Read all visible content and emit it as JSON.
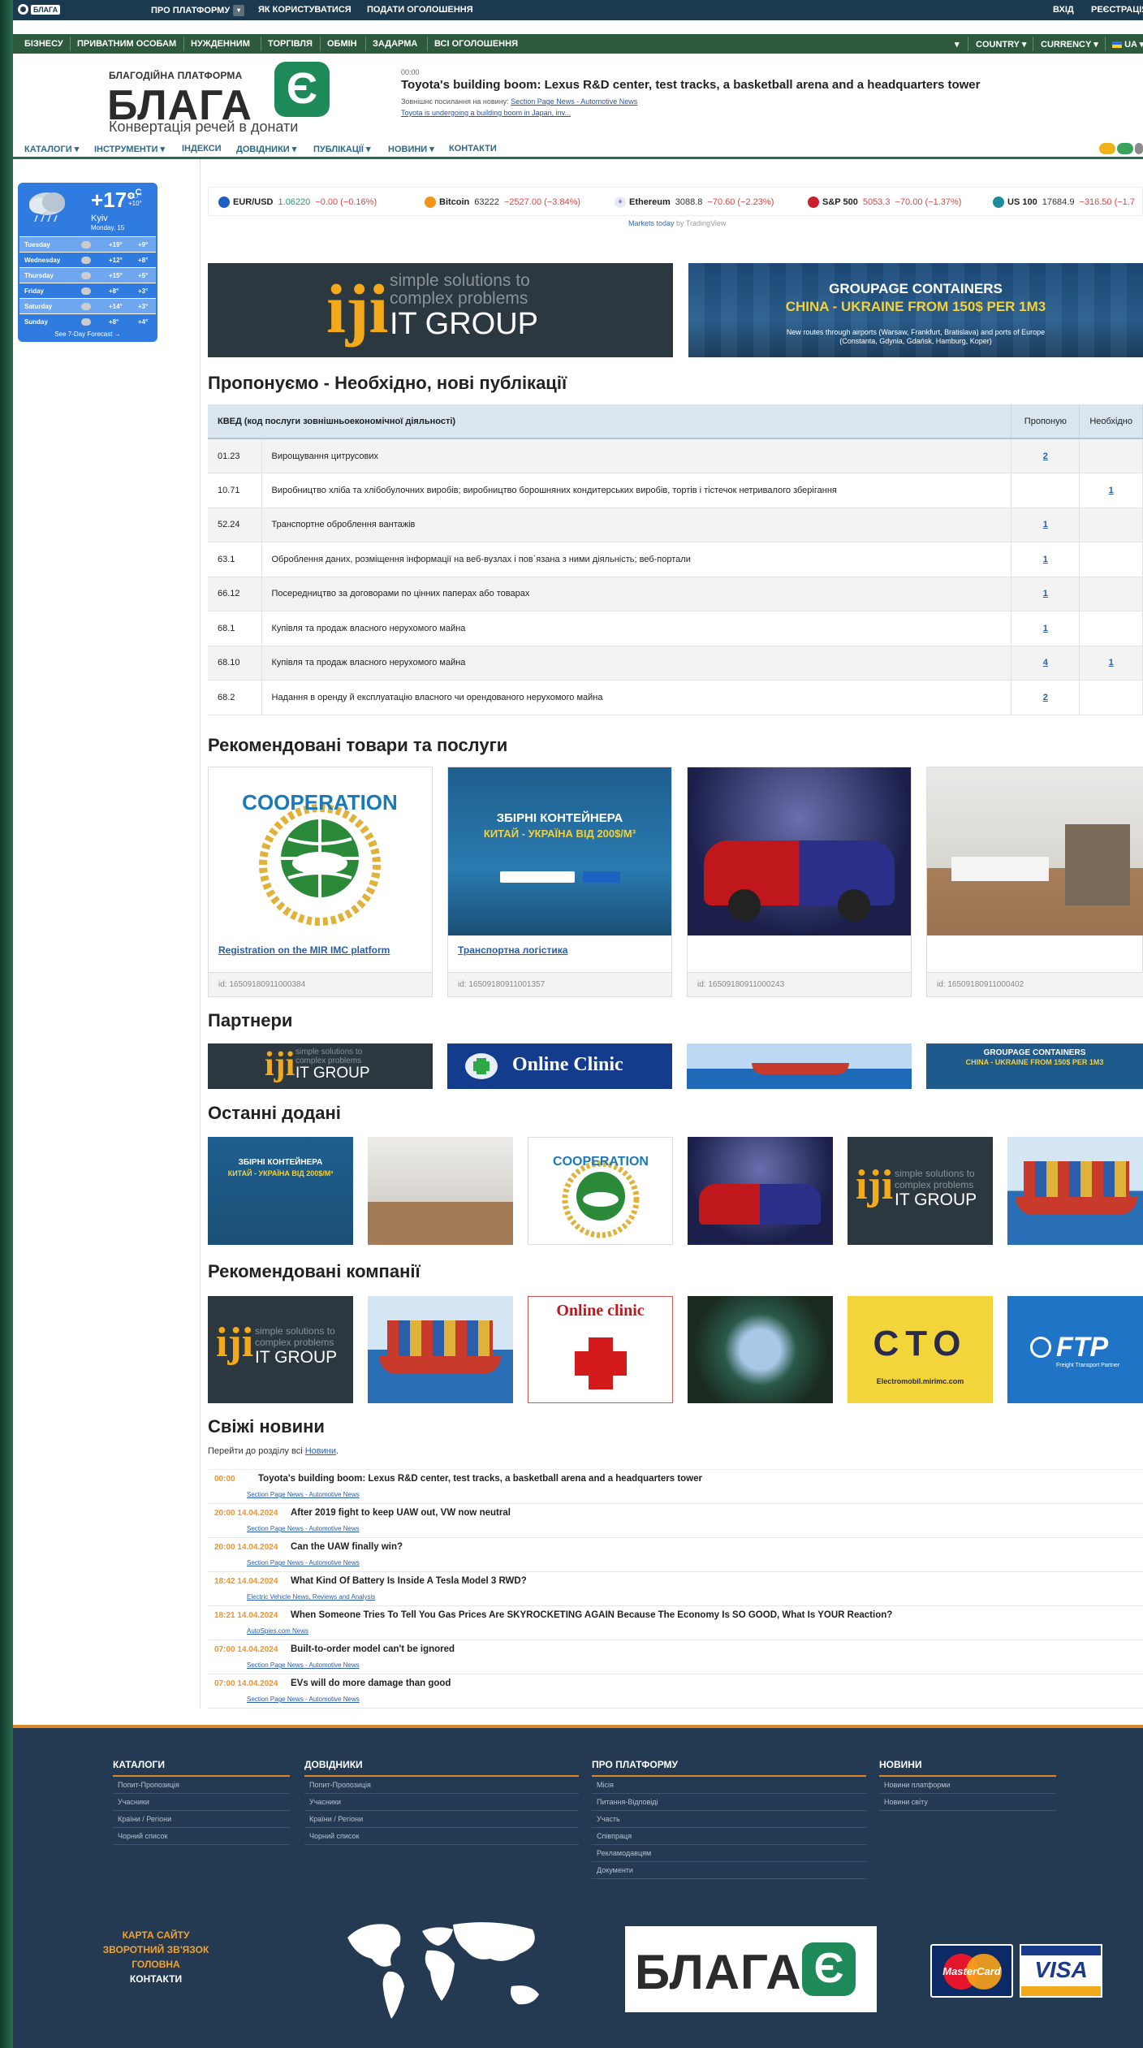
{
  "topbar": {
    "logo_mini": "БЛАГА",
    "items": [
      "ПРО ПЛАТФОРМУ",
      "ЯК КОРИСТУВАТИСЯ",
      "ПОДАТИ ОГОЛОШЕННЯ"
    ],
    "login": "ВХІД",
    "register": "РЕЄСТРАЦІЯ"
  },
  "navbar2": {
    "items": [
      "БІЗНЕСУ",
      "ПРИВАТНИМ ОСОБАМ",
      "НУЖДЕННИМ",
      "ТОРГІВЛЯ",
      "ОБМІН",
      "ЗАДАРМА",
      "ВСІ ОГОЛОШЕННЯ"
    ],
    "country": "COUNTRY",
    "currency": "CURRENCY",
    "lang": "UA"
  },
  "header": {
    "brand_sub": "БЛАГОДІЙНА ПЛАТФОРМА",
    "brand_main": "БЛАГА",
    "brand_e": "Є",
    "brand_tag": "Конвертація речей в донати",
    "news_time": "00:00",
    "news_headline": "Toyota's building boom: Lexus R&D center, test tracks, a basketball arena and a headquarters tower",
    "news_src_label": "Зовнішнє посилання на новину:",
    "news_src_link": "Section Page News - Automotive News",
    "news_next": "Toyota is undergoing a building boom in Japan, inv..."
  },
  "menu3": {
    "items": [
      "КАТАЛОГИ",
      "ІНСТРУМЕНТИ",
      "ІНДЕКСИ",
      "ДОВІДНИКИ",
      "ПУБЛІКАЦІЇ",
      "НОВИНИ",
      "КОНТАКТИ"
    ]
  },
  "weather": {
    "temp": "+17°",
    "unit": "C",
    "high": "+17°",
    "low": "+10°",
    "city": "Kyiv",
    "date": "Monday, 15",
    "days": [
      {
        "day": "Tuesday",
        "hi": "+19°",
        "lo": "+9°"
      },
      {
        "day": "Wednesday",
        "hi": "+12°",
        "lo": "+8°"
      },
      {
        "day": "Thursday",
        "hi": "+15°",
        "lo": "+5°"
      },
      {
        "day": "Friday",
        "hi": "+8°",
        "lo": "+3°"
      },
      {
        "day": "Saturday",
        "hi": "+14°",
        "lo": "+3°"
      },
      {
        "day": "Sunday",
        "hi": "+8°",
        "lo": "+4°"
      }
    ],
    "more": "See 7-Day Forecast →"
  },
  "ticker": {
    "quotes": [
      {
        "name": "EUR/USD",
        "value": "1.06220",
        "change": "−0.00 (−0.16%)",
        "color": "#1f5fbf"
      },
      {
        "name": "Bitcoin",
        "value": "63222",
        "change": "−2527.00 (−3.84%)",
        "color": "#f2931a"
      },
      {
        "name": "Ethereum",
        "value": "3088.8",
        "change": "−70.60 (−2.23%)",
        "color": "#7c8adb"
      },
      {
        "name": "S&P 500",
        "value": "5053.3",
        "change": "−70.00 (−1.37%)",
        "color": "#c9202a"
      },
      {
        "name": "US 100",
        "value": "17684.9",
        "change": "−316.50 (−1.7",
        "color": "#1c8c9c"
      }
    ],
    "caption_link": "Markets today",
    "caption_rest": " by TradingView"
  },
  "banners": {
    "iji": "iji",
    "iji_t1": "simple solutions to",
    "iji_t2": "complex problems",
    "iji_t3": "IT GROUP",
    "groupage_t1": "GROUPAGE CONTAINERS",
    "groupage_t2": "CHINA - UKRAINE FROM 150$ PER 1M3",
    "groupage_t3": "New routes through airports (Warsaw, Frankfurt, Bratislava) and ports of Europe",
    "groupage_t4": "(Constanta, Gdynia, Gdańsk, Hamburg, Koper)"
  },
  "sections": {
    "offers": "Пропонуємо - Необхідно, нові публікації",
    "recommended_goods": "Рекомендовані товари та послуги",
    "partners": "Партнери",
    "latest": "Останні додані",
    "recommended_companies": "Рекомендовані компанії",
    "news": "Свіжі новини"
  },
  "table": {
    "headers": [
      "КВЕД (код послуги зовнішньоекономічної діяльності)",
      "Пропоную",
      "Необхідно"
    ],
    "rows": [
      {
        "code": "01.23",
        "name": "Вирощування цитрусових",
        "offer": "2",
        "need": ""
      },
      {
        "code": "10.71",
        "name": "Виробництво хліба та хлібобулочних виробів; виробництво борошняних кондитерських виробів, тортів і тістечок нетривалого зберігання",
        "offer": "",
        "need": "1"
      },
      {
        "code": "52.24",
        "name": "Транспортне оброблення вантажів",
        "offer": "1",
        "need": ""
      },
      {
        "code": "63.1",
        "name": "Оброблення даних, розміщення інформації на веб-вузлах і пов`язана з ними діяльність; веб-портали",
        "offer": "1",
        "need": ""
      },
      {
        "code": "66.12",
        "name": "Посередництво за договорами по цінних паперах або товарах",
        "offer": "1",
        "need": ""
      },
      {
        "code": "68.1",
        "name": "Купівля та продаж власного нерухомого майна",
        "offer": "1",
        "need": ""
      },
      {
        "code": "68.10",
        "name": "Купівля та продаж власного нерухомого майна",
        "offer": "4",
        "need": "1"
      },
      {
        "code": "68.2",
        "name": "Надання в оренду й експлуатацію власного чи орендованого нерухомого майна",
        "offer": "2",
        "need": ""
      }
    ]
  },
  "products": [
    {
      "label": "Registration on the MIR IMC platform",
      "id": "id: 16509180911000384",
      "img_text": "COOPERATION"
    },
    {
      "label": "Транспортна логістика",
      "id": "id: 16509180911001357",
      "img_t1": "ЗБІРНІ КОНТЕЙНЕРА",
      "img_t2": "КИТАЙ - УКРАЇНА ВІД 200$/М³"
    },
    {
      "label": "",
      "id": "id: 16509180911000243"
    },
    {
      "label": "",
      "id": "id: 16509180911000402"
    }
  ],
  "partners": {
    "clinic": "Online Clinic"
  },
  "companies": {
    "clinic": "Online clinic",
    "cto": "CTO",
    "cto_site": "Electromobil.mirimc.com",
    "ftp": "FTP",
    "ftp_sub": "Freight Transport Partner"
  },
  "news": {
    "lead_text": "Перейти до розділу всі ",
    "lead_link": "Новини",
    "items": [
      {
        "time": "00:00",
        "title": "Toyota's building boom: Lexus R&D center, test tracks, a basketball arena and a headquarters tower",
        "src": "Section Page News - Automotive News"
      },
      {
        "time": "20:00 14.04.2024",
        "title": "After 2019 fight to keep UAW out, VW now neutral",
        "src": "Section Page News - Automotive News"
      },
      {
        "time": "20:00 14.04.2024",
        "title": "Can the UAW finally win?",
        "src": "Section Page News - Automotive News"
      },
      {
        "time": "18:42 14.04.2024",
        "title": "What Kind Of Battery Is Inside A Tesla Model 3 RWD?",
        "src": "Electric Vehicle News, Reviews and Analysis"
      },
      {
        "time": "18:21 14.04.2024",
        "title": "When Someone Tries To Tell You Gas Prices Are SKYROCKETING AGAIN Because The Economy Is SO GOOD, What Is YOUR Reaction?",
        "src": "AutoSpies.com News"
      },
      {
        "time": "07:00 14.04.2024",
        "title": "Built-to-order model can't be ignored",
        "src": "Section Page News - Automotive News"
      },
      {
        "time": "07:00 14.04.2024",
        "title": "EVs will do more damage than good",
        "src": "Section Page News - Automotive News"
      }
    ]
  },
  "footer": {
    "cols": [
      {
        "title": "КАТАЛОГИ",
        "items": [
          "Попит-Пропозиція",
          "Учасники",
          "Країни / Регіони",
          "Чорний список"
        ]
      },
      {
        "title": "ДОВІДНИКИ",
        "items": [
          "Попит-Пропозиція",
          "Учасники",
          "Країни / Регіони",
          "Чорний список"
        ]
      },
      {
        "title": "ПРО ПЛАТФОРМУ",
        "items": [
          "Місія",
          "Питання-Відповіді",
          "Участь",
          "Співпраця",
          "Рекламодавцям",
          "Документи"
        ]
      },
      {
        "title": "НОВИНИ",
        "items": [
          "Новини платформи",
          "Новини світу"
        ]
      }
    ],
    "links": [
      "КАРТА САЙТУ",
      "ЗВОРОТНИЙ ЗВ'ЯЗОК",
      "ГОЛОВНА",
      "КОНТАКТИ"
    ],
    "logo_text": "БЛАГА",
    "logo_e": "Є",
    "mastercard": "MasterCard",
    "visa": "VISA"
  }
}
